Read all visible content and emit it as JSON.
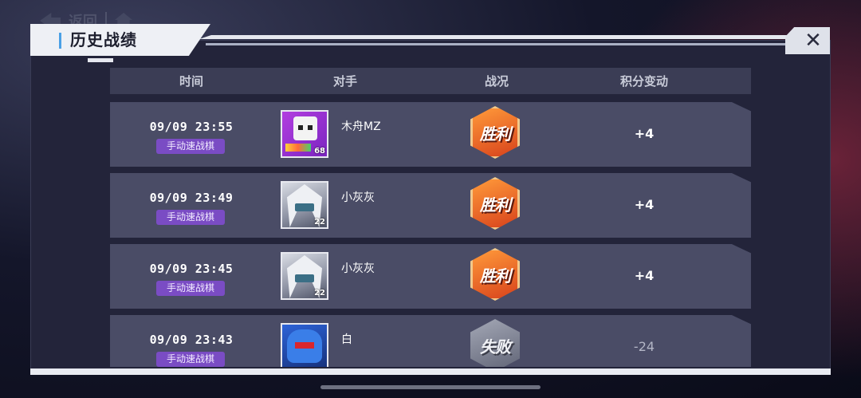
{
  "nav": {
    "back_label": "返回"
  },
  "panel": {
    "title": "历史战绩",
    "close_symbol": "✕"
  },
  "table": {
    "headers": [
      "时间",
      "对手",
      "战况",
      "积分变动"
    ],
    "rows": [
      {
        "time": "09/09 23:55",
        "mode": "手动速战棋",
        "opponent": "木舟MZ",
        "opponent_level": "68",
        "avatar": "purple-robot-avatar",
        "result": "胜利",
        "result_type": "win",
        "points": "+4"
      },
      {
        "time": "09/09 23:49",
        "mode": "手动速战棋",
        "opponent": "小灰灰",
        "opponent_level": "22",
        "avatar": "white-hair-avatar",
        "result": "胜利",
        "result_type": "win",
        "points": "+4"
      },
      {
        "time": "09/09 23:45",
        "mode": "手动速战棋",
        "opponent": "小灰灰",
        "opponent_level": "22",
        "avatar": "white-hair-avatar",
        "result": "胜利",
        "result_type": "win",
        "points": "+4"
      },
      {
        "time": "09/09 23:43",
        "mode": "手动速战棋",
        "opponent": "白",
        "opponent_level": "",
        "avatar": "blue-helmet-avatar",
        "result": "失败",
        "result_type": "lose",
        "points": "-24"
      }
    ]
  },
  "colors": {
    "win": "#e8642a",
    "lose": "#8a8e9e",
    "mode_tag": "#7a4cc4",
    "accent": "#4aa0e6"
  }
}
